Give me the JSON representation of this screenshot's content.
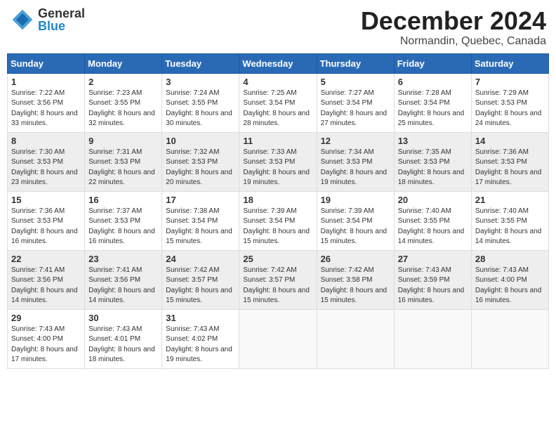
{
  "header": {
    "logo": {
      "line1": "General",
      "line2": "Blue"
    },
    "title": "December 2024",
    "location": "Normandin, Quebec, Canada"
  },
  "calendar": {
    "columns": [
      "Sunday",
      "Monday",
      "Tuesday",
      "Wednesday",
      "Thursday",
      "Friday",
      "Saturday"
    ],
    "weeks": [
      [
        {
          "day": "1",
          "sunrise": "7:22 AM",
          "sunset": "3:56 PM",
          "daylight": "8 hours and 33 minutes."
        },
        {
          "day": "2",
          "sunrise": "7:23 AM",
          "sunset": "3:55 PM",
          "daylight": "8 hours and 32 minutes."
        },
        {
          "day": "3",
          "sunrise": "7:24 AM",
          "sunset": "3:55 PM",
          "daylight": "8 hours and 30 minutes."
        },
        {
          "day": "4",
          "sunrise": "7:25 AM",
          "sunset": "3:54 PM",
          "daylight": "8 hours and 28 minutes."
        },
        {
          "day": "5",
          "sunrise": "7:27 AM",
          "sunset": "3:54 PM",
          "daylight": "8 hours and 27 minutes."
        },
        {
          "day": "6",
          "sunrise": "7:28 AM",
          "sunset": "3:54 PM",
          "daylight": "8 hours and 25 minutes."
        },
        {
          "day": "7",
          "sunrise": "7:29 AM",
          "sunset": "3:53 PM",
          "daylight": "8 hours and 24 minutes."
        }
      ],
      [
        {
          "day": "8",
          "sunrise": "7:30 AM",
          "sunset": "3:53 PM",
          "daylight": "8 hours and 23 minutes."
        },
        {
          "day": "9",
          "sunrise": "7:31 AM",
          "sunset": "3:53 PM",
          "daylight": "8 hours and 22 minutes."
        },
        {
          "day": "10",
          "sunrise": "7:32 AM",
          "sunset": "3:53 PM",
          "daylight": "8 hours and 20 minutes."
        },
        {
          "day": "11",
          "sunrise": "7:33 AM",
          "sunset": "3:53 PM",
          "daylight": "8 hours and 19 minutes."
        },
        {
          "day": "12",
          "sunrise": "7:34 AM",
          "sunset": "3:53 PM",
          "daylight": "8 hours and 19 minutes."
        },
        {
          "day": "13",
          "sunrise": "7:35 AM",
          "sunset": "3:53 PM",
          "daylight": "8 hours and 18 minutes."
        },
        {
          "day": "14",
          "sunrise": "7:36 AM",
          "sunset": "3:53 PM",
          "daylight": "8 hours and 17 minutes."
        }
      ],
      [
        {
          "day": "15",
          "sunrise": "7:36 AM",
          "sunset": "3:53 PM",
          "daylight": "8 hours and 16 minutes."
        },
        {
          "day": "16",
          "sunrise": "7:37 AM",
          "sunset": "3:53 PM",
          "daylight": "8 hours and 16 minutes."
        },
        {
          "day": "17",
          "sunrise": "7:38 AM",
          "sunset": "3:54 PM",
          "daylight": "8 hours and 15 minutes."
        },
        {
          "day": "18",
          "sunrise": "7:39 AM",
          "sunset": "3:54 PM",
          "daylight": "8 hours and 15 minutes."
        },
        {
          "day": "19",
          "sunrise": "7:39 AM",
          "sunset": "3:54 PM",
          "daylight": "8 hours and 15 minutes."
        },
        {
          "day": "20",
          "sunrise": "7:40 AM",
          "sunset": "3:55 PM",
          "daylight": "8 hours and 14 minutes."
        },
        {
          "day": "21",
          "sunrise": "7:40 AM",
          "sunset": "3:55 PM",
          "daylight": "8 hours and 14 minutes."
        }
      ],
      [
        {
          "day": "22",
          "sunrise": "7:41 AM",
          "sunset": "3:56 PM",
          "daylight": "8 hours and 14 minutes."
        },
        {
          "day": "23",
          "sunrise": "7:41 AM",
          "sunset": "3:56 PM",
          "daylight": "8 hours and 14 minutes."
        },
        {
          "day": "24",
          "sunrise": "7:42 AM",
          "sunset": "3:57 PM",
          "daylight": "8 hours and 15 minutes."
        },
        {
          "day": "25",
          "sunrise": "7:42 AM",
          "sunset": "3:57 PM",
          "daylight": "8 hours and 15 minutes."
        },
        {
          "day": "26",
          "sunrise": "7:42 AM",
          "sunset": "3:58 PM",
          "daylight": "8 hours and 15 minutes."
        },
        {
          "day": "27",
          "sunrise": "7:43 AM",
          "sunset": "3:59 PM",
          "daylight": "8 hours and 16 minutes."
        },
        {
          "day": "28",
          "sunrise": "7:43 AM",
          "sunset": "4:00 PM",
          "daylight": "8 hours and 16 minutes."
        }
      ],
      [
        {
          "day": "29",
          "sunrise": "7:43 AM",
          "sunset": "4:00 PM",
          "daylight": "8 hours and 17 minutes."
        },
        {
          "day": "30",
          "sunrise": "7:43 AM",
          "sunset": "4:01 PM",
          "daylight": "8 hours and 18 minutes."
        },
        {
          "day": "31",
          "sunrise": "7:43 AM",
          "sunset": "4:02 PM",
          "daylight": "8 hours and 19 minutes."
        },
        null,
        null,
        null,
        null
      ]
    ]
  }
}
